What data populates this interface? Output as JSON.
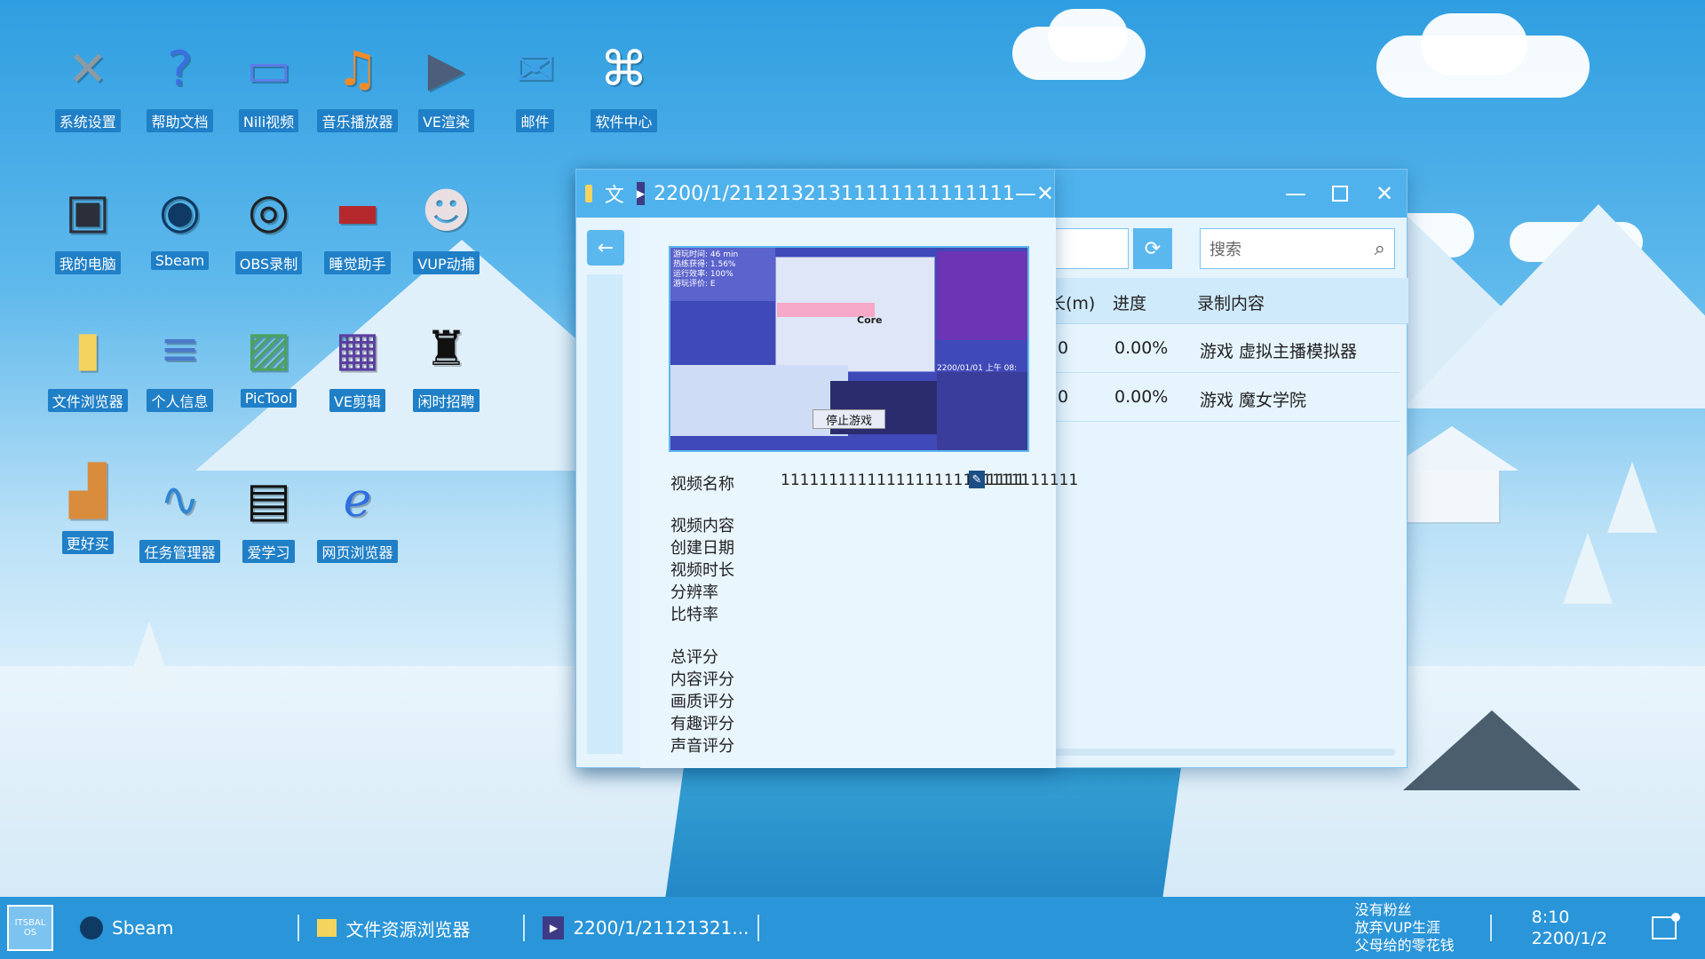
{
  "desktop_icons": [
    {
      "label": "系统设置",
      "icon": "wrench-icon"
    },
    {
      "label": "帮助文档",
      "icon": "help-icon"
    },
    {
      "label": "Nili视频",
      "icon": "tv-icon"
    },
    {
      "label": "音乐播放器",
      "icon": "music-icon"
    },
    {
      "label": "VE渲染",
      "icon": "render-icon"
    },
    {
      "label": "邮件",
      "icon": "mail-icon"
    },
    {
      "label": "软件中心",
      "icon": "app-center-icon"
    },
    {
      "label": "我的电脑",
      "icon": "computer-icon"
    },
    {
      "label": "Sbeam",
      "icon": "sbeam-icon"
    },
    {
      "label": "OBS录制",
      "icon": "obs-icon"
    },
    {
      "label": "睡觉助手",
      "icon": "bed-icon"
    },
    {
      "label": "VUP动捕",
      "icon": "vup-icon"
    },
    {
      "label": "文件浏览器",
      "icon": "folder-icon"
    },
    {
      "label": "个人信息",
      "icon": "info-icon"
    },
    {
      "label": "PicTool",
      "icon": "picture-icon"
    },
    {
      "label": "VE剪辑",
      "icon": "video-edit-icon"
    },
    {
      "label": "闲时招聘",
      "icon": "hat-icon"
    },
    {
      "label": "更好买",
      "icon": "shop-icon"
    },
    {
      "label": "任务管理器",
      "icon": "chart-icon"
    },
    {
      "label": "爱学习",
      "icon": "study-icon"
    },
    {
      "label": "网页浏览器",
      "icon": "browser-icon"
    }
  ],
  "file_window": {
    "search_placeholder": "搜索",
    "columns": [
      "长(m)",
      "进度",
      "录制内容"
    ],
    "rows": [
      {
        "length": "0",
        "progress": "0.00%",
        "content": "游戏 虚拟主播模拟器"
      },
      {
        "length": "0",
        "progress": "0.00%",
        "content": "游戏 魔女学院"
      }
    ]
  },
  "video_window": {
    "title_prefix": "文",
    "title": "2200/1/21121321311111111111111",
    "thumb_button": "停止游戏",
    "thumb_stats": [
      "游玩时间: 46 min",
      "热练获得: 1.56%",
      "运行效率: 100%",
      "游玩评价: E"
    ],
    "thumb_core": "Core",
    "thumb_time": "2200/01/01 上午 08:",
    "name_label": "视频名称",
    "name_value": "1111111111111111111111111111111",
    "name_tail": "1111",
    "fields": [
      "视频内容",
      "创建日期",
      "视频时长",
      "分辨率",
      "比特率"
    ],
    "scores": [
      "总评分",
      "内容评分",
      "画质评分",
      "有趣评分",
      "声音评分"
    ]
  },
  "taskbar": {
    "start_label": "ITSBAL OS",
    "items": [
      "Sbeam",
      "文件资源浏览器",
      "2200/1/21121321..."
    ],
    "status_lines": [
      "没有粉丝",
      "放弃VUP生涯",
      "父母给的零花钱"
    ],
    "time": "8:10",
    "date": "2200/1/2"
  },
  "colors": {
    "accent": "#4fb2ec",
    "taskbar": "#2a95d8",
    "label_bg": "#1f7fc7"
  }
}
